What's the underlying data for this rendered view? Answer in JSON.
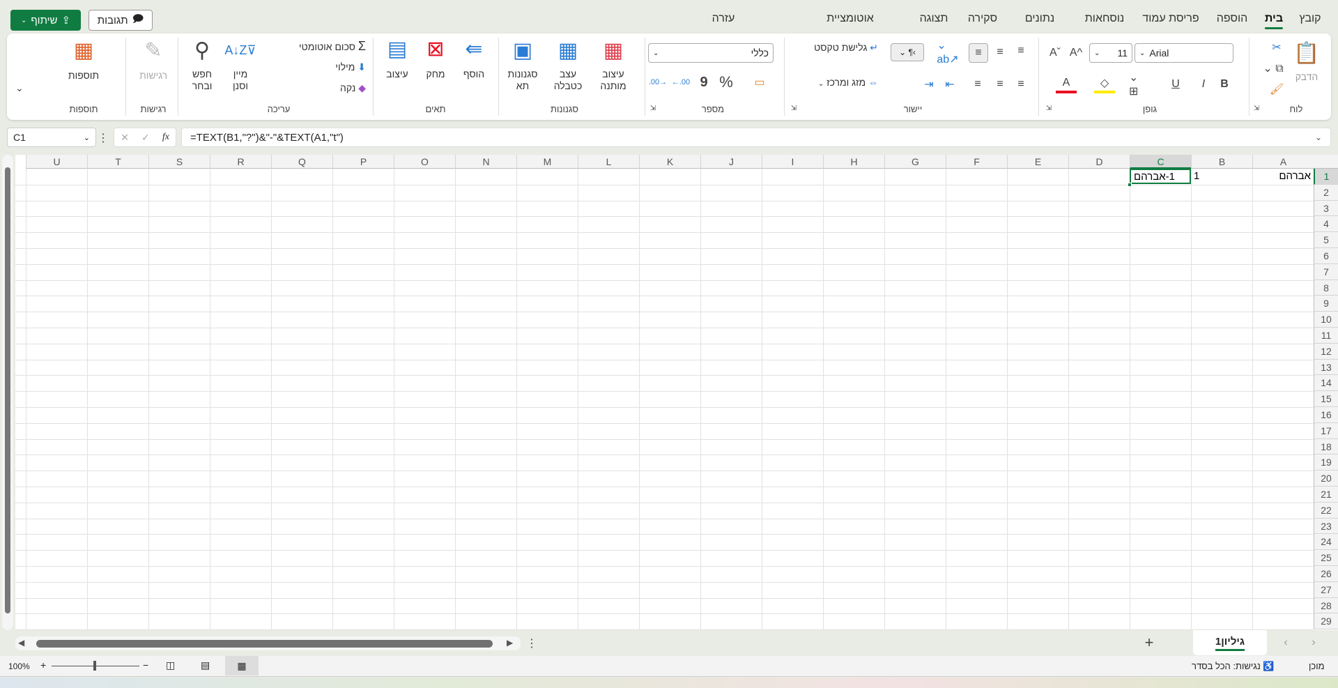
{
  "header": {
    "share": "שיתוף",
    "comments": "תגובות",
    "tabs": [
      "קובץ",
      "בית",
      "הוספה",
      "פריסת עמוד",
      "נוסחאות",
      "נתונים",
      "סקירה",
      "תצוגה",
      "אוטומציית",
      "עזרה"
    ],
    "active_tab": "בית"
  },
  "ribbon": {
    "clipboard": {
      "group": "לוח",
      "paste": "הדבק"
    },
    "font": {
      "group": "גופן",
      "name": "Arial",
      "size": "11",
      "bold": "B",
      "italic": "I",
      "underline": "U",
      "grow": "A^",
      "shrink": "Aˇ",
      "font_color": "#e81123",
      "fill_color": "#ffeb00"
    },
    "alignment": {
      "group": "יישור",
      "wrap": "גלישת טקסט",
      "merge": "מזג ומרכז"
    },
    "number": {
      "group": "מספר",
      "format": "כללי",
      "percent": "%",
      "comma": "9"
    },
    "styles": {
      "group": "סגנונות",
      "conditional": [
        "עיצוב",
        "מותנה"
      ],
      "table": [
        "עצב",
        "כטבלה"
      ],
      "cell": [
        "סגנונות",
        "תא"
      ]
    },
    "cells": {
      "group": "תאים",
      "insert": "הוסף",
      "delete": "מחק",
      "format": "עיצוב"
    },
    "editing": {
      "group": "עריכה",
      "autosum": "סכום אוטומטי",
      "fill": "מילוי",
      "clear": "נקה",
      "sort": [
        "מיין",
        "וסנן"
      ],
      "find": [
        "חפש",
        "ובחר"
      ]
    },
    "sensitivity": {
      "group": "רגישות",
      "label": "רגישות"
    },
    "addins": {
      "group": "תוספות",
      "label": "תוספות"
    }
  },
  "formula_bar": {
    "name_box": "C1",
    "fx": "fx",
    "formula": "=TEXT(B1,\"?\")&\"-\"&TEXT(A1,\"t\")"
  },
  "sheet": {
    "columns": [
      "A",
      "B",
      "C",
      "D",
      "E",
      "F",
      "G",
      "H",
      "I",
      "J",
      "K",
      "L",
      "M",
      "N",
      "O",
      "P",
      "Q",
      "R",
      "S",
      "T",
      "U"
    ],
    "rows": [
      "1",
      "2",
      "3",
      "4",
      "5",
      "6",
      "7",
      "8",
      "9",
      "10",
      "11",
      "12",
      "13",
      "14",
      "15",
      "16",
      "17",
      "18",
      "19",
      "20",
      "21",
      "22",
      "23",
      "24",
      "25",
      "26",
      "27",
      "28",
      "29"
    ],
    "cells": {
      "A1": "אברהם",
      "B1": "1",
      "C1": "1-אברהם"
    },
    "selected": "C1",
    "accent": "#107c41"
  },
  "sheet_tabs": {
    "tabs": [
      "גיליון1"
    ],
    "add": "+"
  },
  "status": {
    "ready": "מוכן",
    "accessibility": "נגישות: הכל בסדר",
    "zoom": "100%"
  }
}
